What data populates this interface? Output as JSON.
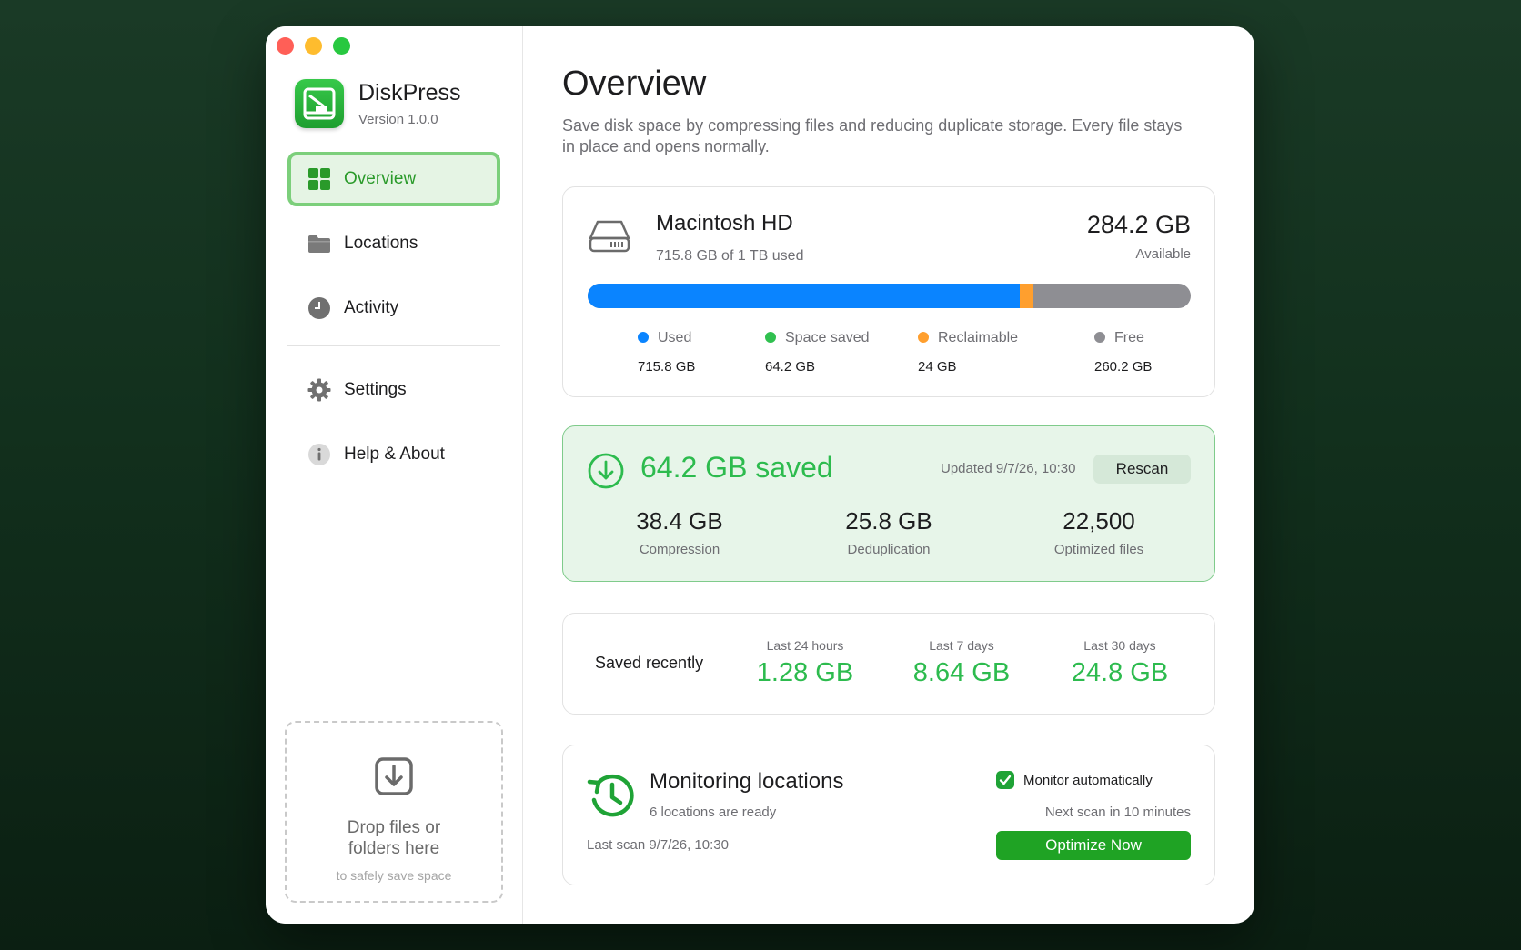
{
  "app": {
    "name": "DiskPress",
    "version": "Version 1.0.0",
    "icon": "app-icon-disk-press"
  },
  "sidebar": {
    "items": [
      {
        "label": "Overview",
        "icon": "grid-icon",
        "active": true
      },
      {
        "label": "Locations",
        "icon": "folder-icon",
        "active": false
      },
      {
        "label": "Activity",
        "icon": "clock-icon",
        "active": false
      },
      {
        "label": "Settings",
        "icon": "gear-icon",
        "active": false
      },
      {
        "label": "Help & About",
        "icon": "info-icon",
        "active": false
      }
    ],
    "drop": {
      "title": "Drop files or folders here",
      "subtitle": "to safely save space",
      "icon": "download-icon"
    }
  },
  "page": {
    "title": "Overview",
    "description": "Save disk space by compressing files and reducing duplicate storage. Every file stays in place and opens normally."
  },
  "disk": {
    "name": "Macintosh HD",
    "usage_text": "715.8 GB of 1 TB used",
    "available_value": "284.2 GB",
    "available_label": "Available",
    "bar": {
      "used_fraction": 0.7158,
      "reclaimable_fraction": 0.024,
      "colors": {
        "used": "#0a84ff",
        "reclaimable": "#ff9f2e",
        "free": "#8e8e93"
      }
    },
    "legend": [
      {
        "label": "Used",
        "value": "715.8 GB",
        "color": "#0a84ff"
      },
      {
        "label": "Space saved",
        "value": "64.2 GB",
        "color": "#30c04f"
      },
      {
        "label": "Reclaimable",
        "value": "24 GB",
        "color": "#ff9f2e"
      },
      {
        "label": "Free",
        "value": "260.2 GB",
        "color": "#8e8e93"
      }
    ]
  },
  "savings": {
    "title": "64.2 GB saved",
    "updated": "Updated 9/7/26, 10:30",
    "rescan_label": "Rescan",
    "stats": [
      {
        "value": "38.4 GB",
        "label": "Compression"
      },
      {
        "value": "25.8 GB",
        "label": "Deduplication"
      },
      {
        "value": "22,500",
        "label": "Optimized files"
      }
    ]
  },
  "recent": {
    "title": "Saved recently",
    "periods": [
      {
        "label": "Last 24 hours",
        "value": "1.28 GB"
      },
      {
        "label": "Last 7 days",
        "value": "8.64 GB"
      },
      {
        "label": "Last 30 days",
        "value": "24.8 GB"
      }
    ]
  },
  "monitoring": {
    "title": "Monitoring locations",
    "subtitle": "6 locations are ready",
    "last_scan": "Last scan 9/7/26, 10:30",
    "auto_label": "Monitor automatically",
    "auto_checked": true,
    "next_scan": "Next scan in 10 minutes",
    "optimize_label": "Optimize Now"
  },
  "colors": {
    "accent": "#1fa324",
    "saved_green": "#2dbb4e"
  }
}
